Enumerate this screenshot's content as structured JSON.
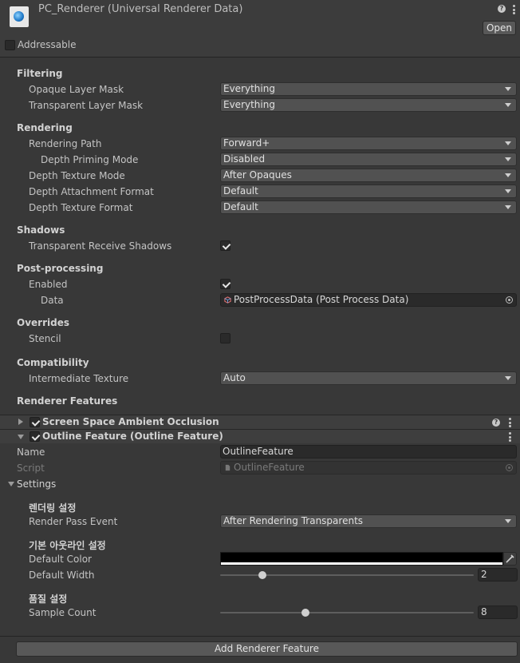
{
  "header": {
    "title": "PC_Renderer (Universal Renderer Data)",
    "open_label": "Open",
    "addressable_label": "Addressable",
    "addressable_checked": false,
    "help_glyph": "?"
  },
  "filtering": {
    "section": "Filtering",
    "opaque_label": "Opaque Layer Mask",
    "opaque_value": "Everything",
    "transparent_label": "Transparent Layer Mask",
    "transparent_value": "Everything"
  },
  "rendering": {
    "section": "Rendering",
    "path_label": "Rendering Path",
    "path_value": "Forward+",
    "priming_label": "Depth Priming Mode",
    "priming_value": "Disabled",
    "depth_tex_mode_label": "Depth Texture Mode",
    "depth_tex_mode_value": "After Opaques",
    "attach_fmt_label": "Depth Attachment Format",
    "attach_fmt_value": "Default",
    "tex_fmt_label": "Depth Texture Format",
    "tex_fmt_value": "Default"
  },
  "shadows": {
    "section": "Shadows",
    "receive_label": "Transparent Receive Shadows",
    "receive_checked": true
  },
  "postprocessing": {
    "section": "Post-processing",
    "enabled_label": "Enabled",
    "enabled_checked": true,
    "data_label": "Data",
    "data_value": "PostProcessData (Post Process Data)"
  },
  "overrides": {
    "section": "Overrides",
    "stencil_label": "Stencil",
    "stencil_checked": false
  },
  "compatibility": {
    "section": "Compatibility",
    "intermediate_label": "Intermediate Texture",
    "intermediate_value": "Auto"
  },
  "features": {
    "section": "Renderer Features",
    "ssao_label": "Screen Space Ambient Occlusion",
    "ssao_enabled": true,
    "outline_label": "Outline Feature (Outline Feature)",
    "outline_enabled": true,
    "name_label": "Name",
    "name_value": "OutlineFeature",
    "script_label": "Script",
    "script_value": "OutlineFeature",
    "settings_label": "Settings",
    "render_group": "렌더링 설정",
    "render_pass_label": "Render Pass Event",
    "render_pass_value": "After Rendering Transparents",
    "outline_group": "기본 아웃라인 설정",
    "color_label": "Default Color",
    "color_value": "#000000",
    "width_label": "Default Width",
    "width_value": "2",
    "quality_group": "품질 설정",
    "sample_label": "Sample Count",
    "sample_value": "8",
    "add_button": "Add Renderer Feature"
  }
}
